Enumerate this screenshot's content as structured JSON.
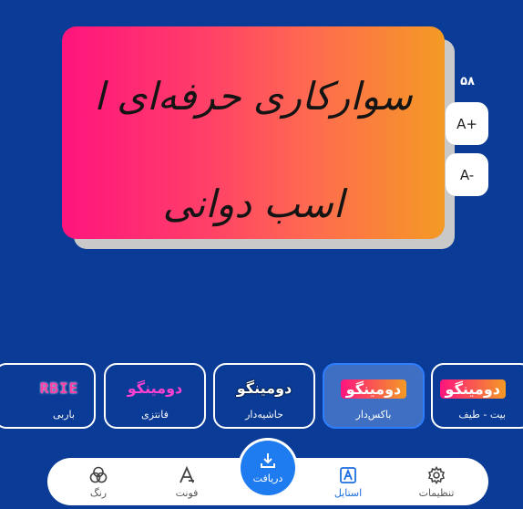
{
  "preview": {
    "line1": "سوارکاری حرفه‌ای ا",
    "line2": "اسب دوانی"
  },
  "font_size": {
    "value": "۵۸",
    "increase_label": "A+",
    "decrease_label": "A-"
  },
  "styles": [
    {
      "preview": "RBIE",
      "label": "باربی",
      "style": "barbie"
    },
    {
      "preview": "دومینگو",
      "label": "فانتزی",
      "style": "fantasy"
    },
    {
      "preview": "دومینگو",
      "label": "حاشیه‌دار",
      "style": "outline"
    },
    {
      "preview": "دومینگو",
      "label": "باکس‌دار",
      "style": "boxed",
      "selected": true
    },
    {
      "preview": "دومینگو",
      "label": "بیت - طیف",
      "style": "gradient"
    }
  ],
  "nav": {
    "color_label": "رنگ",
    "font_label": "فونت",
    "download_label": "دریافت",
    "style_label": "استایل",
    "settings_label": "تنظیمات"
  },
  "colors": {
    "background": "#0A3B96",
    "accent": "#1E7BF0",
    "card_gradient_start": "#FF147E",
    "card_gradient_end": "#F49A24"
  }
}
